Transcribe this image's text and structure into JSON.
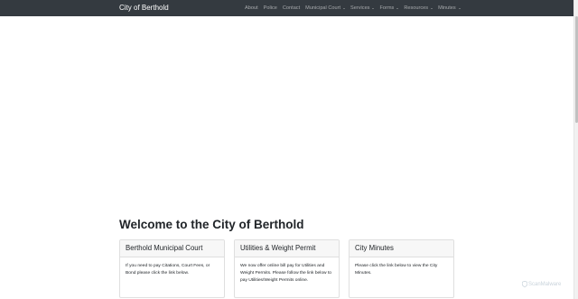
{
  "navbar": {
    "brand": "City of Berthold",
    "items": [
      {
        "label": "About",
        "dropdown": false
      },
      {
        "label": "Police",
        "dropdown": false
      },
      {
        "label": "Contact",
        "dropdown": false
      },
      {
        "label": "Municipal Court",
        "dropdown": true
      },
      {
        "label": "Services",
        "dropdown": true
      },
      {
        "label": "Forms",
        "dropdown": true
      },
      {
        "label": "Resources",
        "dropdown": true
      },
      {
        "label": "Minutes",
        "dropdown": true
      }
    ]
  },
  "main": {
    "heading": "Welcome to the City of Berthold",
    "cards": [
      {
        "title": "Berthold Municipal Court",
        "body": "If you need to pay Citations, Court Fees, or Bond please click the link below."
      },
      {
        "title": "Utilities & Weight Permit",
        "body": "We now offer online bill pay for Utilities and Weight Permits. Please follow the link below to pay Utilities/Weight Permits online."
      },
      {
        "title": "City Minutes",
        "body": "Please click the link below to view the City Minutes."
      }
    ]
  },
  "watermark": {
    "text": "ScanMalware",
    "icon": "shield-icon"
  },
  "colors": {
    "navbar_bg": "#343a40",
    "nav_text": "#8e9194",
    "card_header_bg": "#f7f7f7",
    "border": "#dfdfdf"
  }
}
